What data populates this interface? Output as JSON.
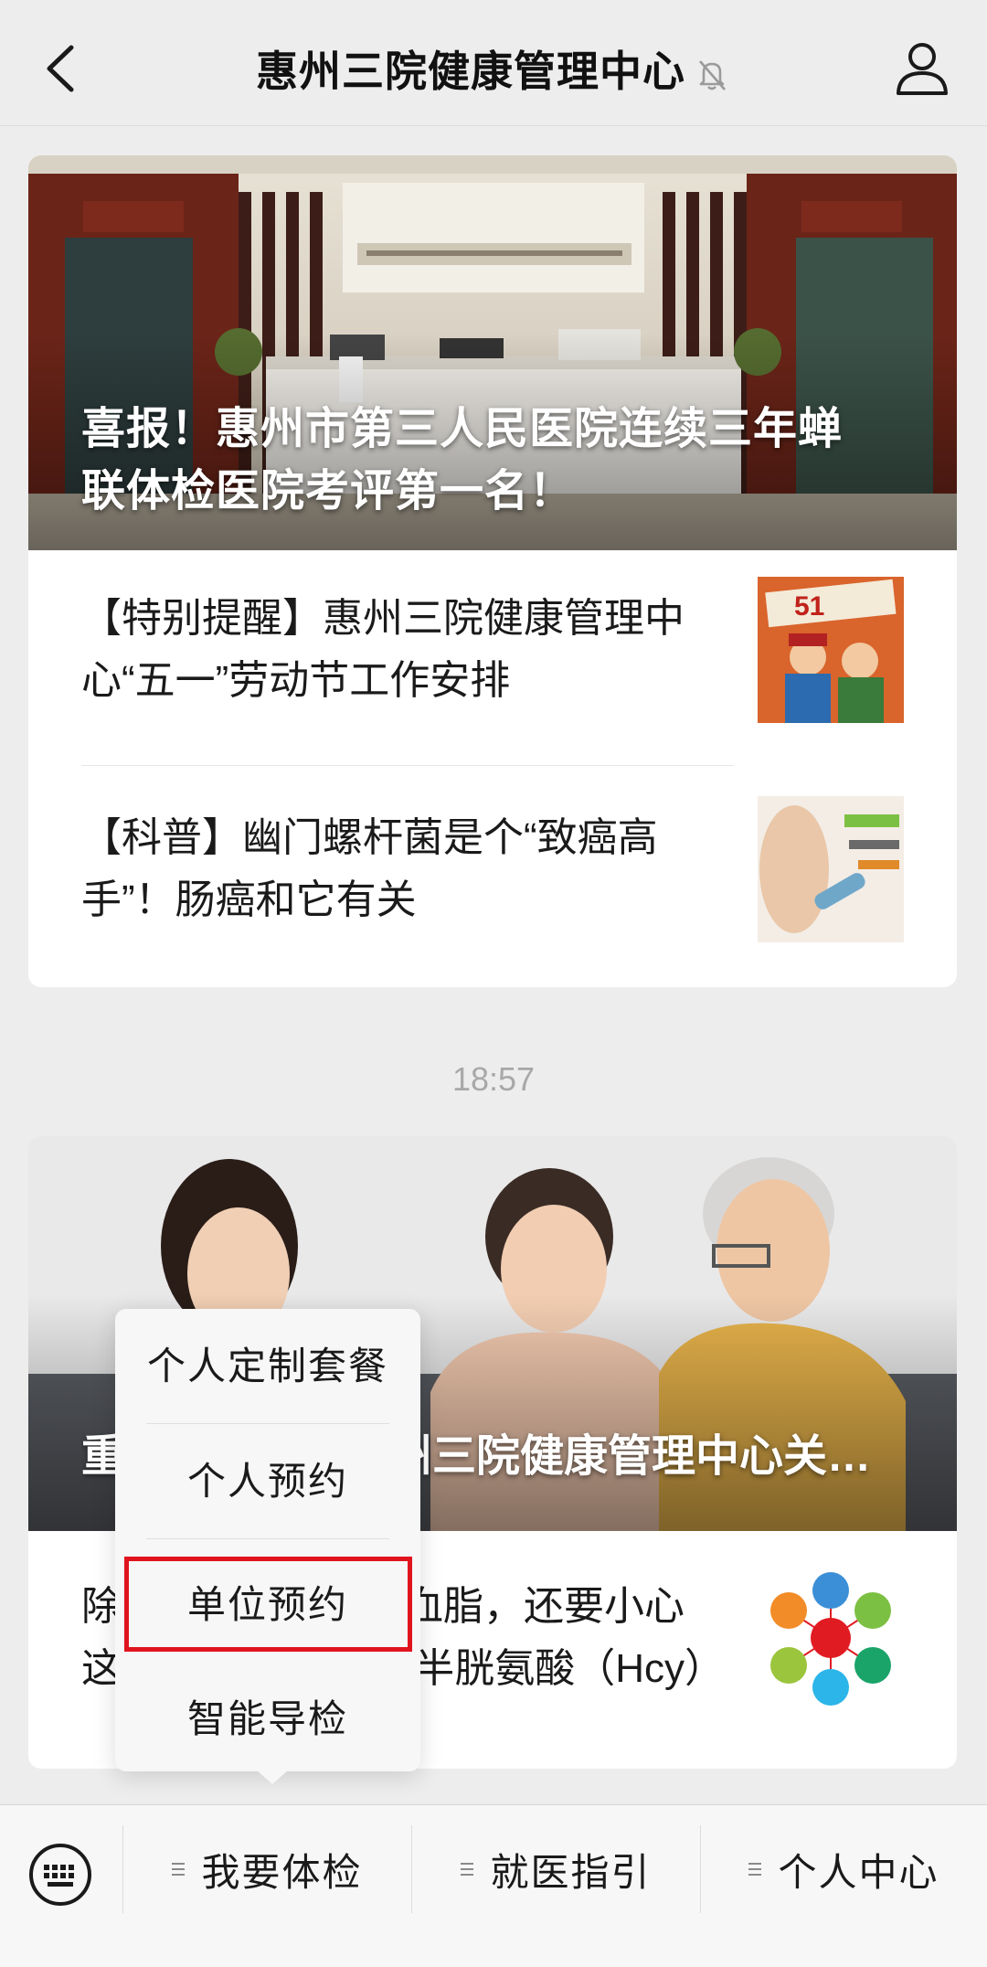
{
  "header": {
    "title": "惠州三院健康管理中心",
    "back_icon": "chevron-left-icon",
    "mute_icon": "bell-muted-icon",
    "profile_icon": "person-icon"
  },
  "card1": {
    "hero_title": "喜报！惠州市第三人民医院连续三年蝉联体检医院考评第一名！",
    "articles": [
      {
        "title": "【特别提醒】惠州三院健康管理中心“五一”劳动节工作安排"
      },
      {
        "title": "【科普】幽门螺杆菌是个“致癌高手”！肠癌和它有关"
      }
    ]
  },
  "timestamp": "18:57",
  "card2": {
    "hero_title": "重阳节献礼！惠州三院健康管理中心关爱父母健康体检套...",
    "article_title": "除了血压、血糖、血脂，还要小心这一高！—— 同型半胱氨酸（Hcy）"
  },
  "popup_menu": {
    "items": [
      "个人定制套餐",
      "个人预约",
      "单位预约",
      "智能导检"
    ],
    "highlighted_index": 2,
    "highlight_color": "#e0141e"
  },
  "bottom_bar": {
    "keyboard_icon": "keyboard-icon",
    "tabs": [
      "我要体检",
      "就医指引",
      "个人中心"
    ]
  }
}
